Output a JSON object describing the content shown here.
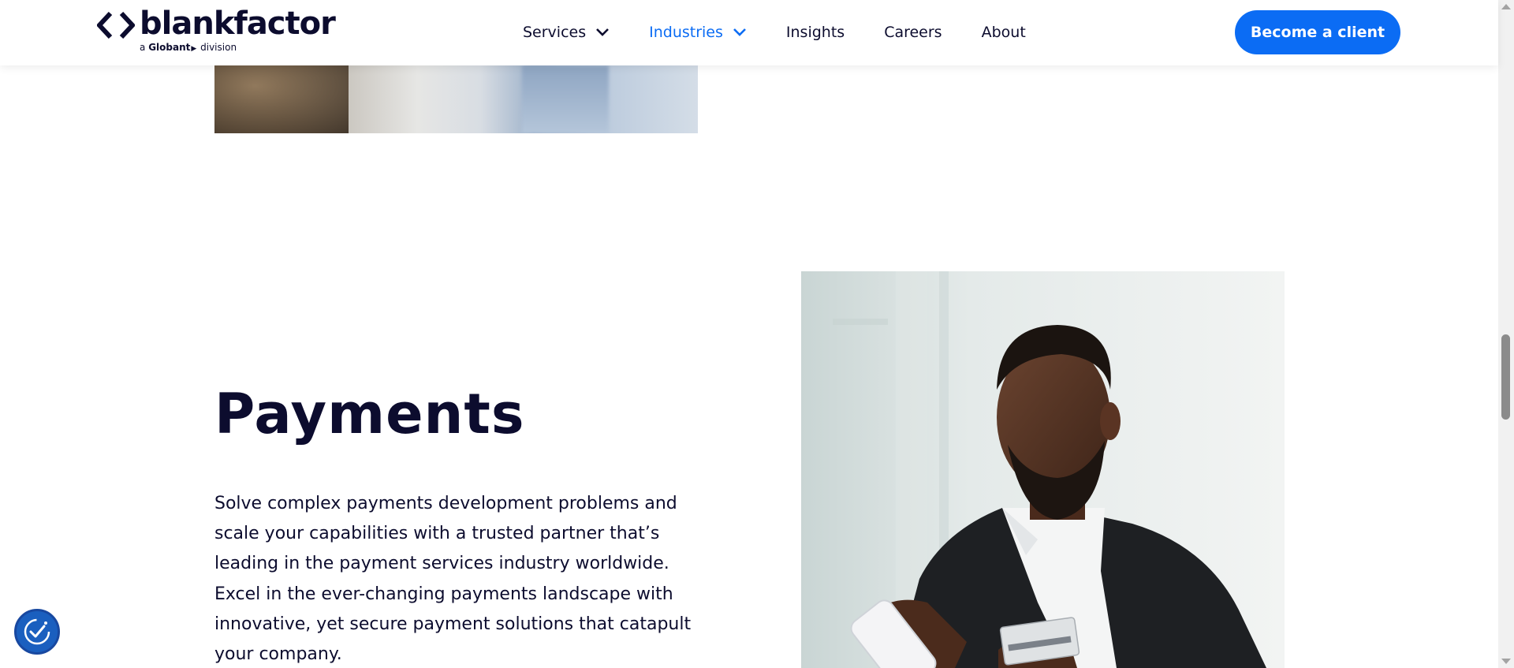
{
  "brand": {
    "name": "blankfactor",
    "sub_prefix": "a",
    "sub_company": "Globant",
    "sub_suffix": "division"
  },
  "nav": {
    "items": [
      {
        "label": "Services",
        "has_dropdown": true,
        "active": false
      },
      {
        "label": "Industries",
        "has_dropdown": true,
        "active": true
      },
      {
        "label": "Insights",
        "has_dropdown": false,
        "active": false
      },
      {
        "label": "Careers",
        "has_dropdown": false,
        "active": false
      },
      {
        "label": "About",
        "has_dropdown": false,
        "active": false
      }
    ],
    "cta_label": "Become a client"
  },
  "section": {
    "heading": "Payments",
    "body": "Solve complex payments development problems and scale your capabilities with a trusted partner that’s leading in the payment services industry worldwide. Excel in the ever-changing payments landscape with innovative, yet secure payment solutions that catapult your company."
  },
  "colors": {
    "accent": "#0b6cf4",
    "text": "#0c0c2e",
    "widget": "#1a5fbf"
  },
  "icons": {
    "nav_dropdown": "chevron-down-icon",
    "widget": "accessibility-check-icon",
    "logo": "code-brackets-icon"
  }
}
